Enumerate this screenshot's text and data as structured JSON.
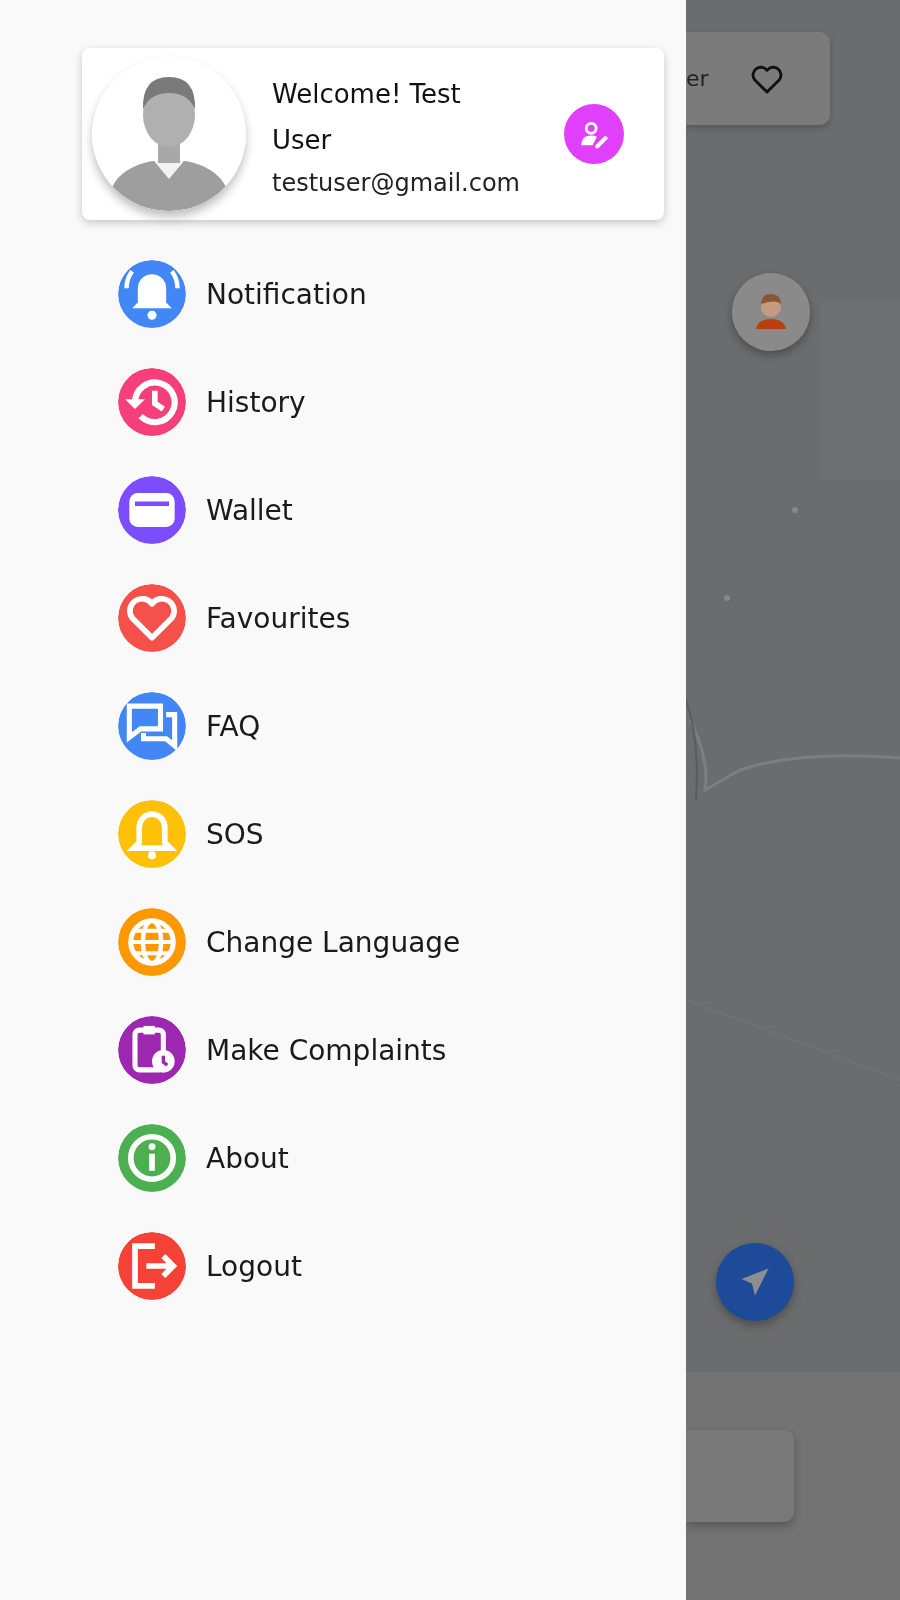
{
  "profile": {
    "greeting": "Welcome! Test User",
    "email": "testuser@gmail.com"
  },
  "menu": [
    {
      "label": "Notification",
      "kind": "notification",
      "color": "#4287f5"
    },
    {
      "label": "History",
      "kind": "history",
      "color": "#f43f7a"
    },
    {
      "label": "Wallet",
      "kind": "wallet",
      "color": "#7c4dff"
    },
    {
      "label": "Favourites",
      "kind": "favourites",
      "color": "#f5504a"
    },
    {
      "label": "FAQ",
      "kind": "faq",
      "color": "#4287f5"
    },
    {
      "label": "SOS",
      "kind": "sos",
      "color": "#ffc107"
    },
    {
      "label": "Change Language",
      "kind": "language",
      "color": "#ff9800"
    },
    {
      "label": "Make Complaints",
      "kind": "complaints",
      "color": "#9c27b0"
    },
    {
      "label": "About",
      "kind": "about",
      "color": "#4caf50"
    },
    {
      "label": "Logout",
      "kind": "logout",
      "color": "#f44336"
    }
  ],
  "background": {
    "top_card_text": "er"
  }
}
